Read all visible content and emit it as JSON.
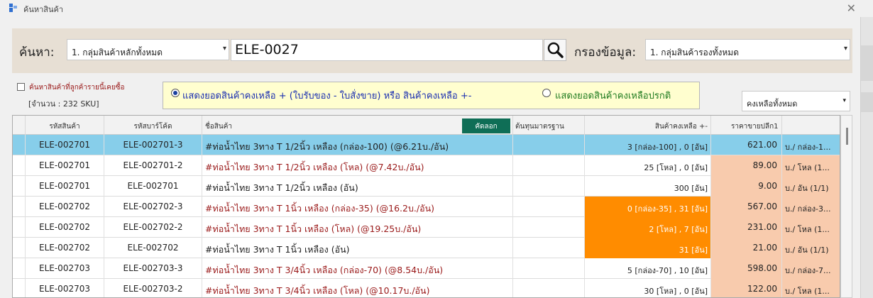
{
  "window": {
    "title": "ค้นหาสินค้า"
  },
  "search": {
    "label": "ค้นหา:",
    "group": "1. กลุ่มสินค้าหลักทั้งหมด",
    "query": "ELE-0027",
    "filter_label": "กรองข้อมูล:",
    "filter": "1. กลุ่มสินค้ารองทั้งหมด"
  },
  "options": {
    "customer_checkbox": "ค้นหาสินค้าที่ลูกค้ารายนี้เคยซื้อ",
    "sku_count": "[จำนวน : 232 SKU]",
    "radio1": "แสดงยอดสินค้าคงเหลือ + (ใบรับของ - ใบสั่งขาย)   หรือ   สินค้าคงเหลือ +-",
    "radio2": "แสดงยอดสินค้าคงเหลือปรกติ",
    "stock_filter": "คงเหลือทั้งหมด"
  },
  "grid": {
    "headers": [
      "รหัสสินค้า",
      "รหัสบาร์โค้ด",
      "ชื่อสินค้า",
      "ต้นทุนมาตรฐาน",
      "สินค้าคงเหลือ +-",
      "ราคาขายปลีก1"
    ],
    "copy_label": "คัดลอก",
    "rows": [
      {
        "code": "ELE-002701",
        "barcode": "ELE-002701-3",
        "name": "#ท่อน้ำไทย 3ทาง T 1/2นิ้ว เหลือง (กล่อง-100) (@6.21บ./อัน)",
        "cost": "",
        "stock": "3 [กล่อง-100] , 0 [อัน]",
        "price": "621.00",
        "unit": "บ./ กล่อง-1..."
      },
      {
        "code": "ELE-002701",
        "barcode": "ELE-002701-2",
        "name": "#ท่อน้ำไทย 3ทาง T 1/2นิ้ว เหลือง (โหล) (@7.42บ./อัน)",
        "cost": "",
        "stock": "25 [โหล] , 0 [อัน]",
        "price": "89.00",
        "unit": "บ./ โหล (1..."
      },
      {
        "code": "ELE-002701",
        "barcode": "ELE-002701",
        "name": "#ท่อน้ำไทย 3ทาง T 1/2นิ้ว เหลือง (อัน)",
        "cost": "",
        "stock": "300 [อัน]",
        "price": "9.00",
        "unit": "บ./ อัน (1/1)"
      },
      {
        "code": "ELE-002702",
        "barcode": "ELE-002702-3",
        "name": "#ท่อน้ำไทย 3ทาง T 1นิ้ว เหลือง (กล่อง-35) (@16.2บ./อัน)",
        "cost": "",
        "stock": "0 [กล่อง-35] , 31 [อัน]",
        "price": "567.00",
        "unit": "บ./ กล่อง-3..."
      },
      {
        "code": "ELE-002702",
        "barcode": "ELE-002702-2",
        "name": "#ท่อน้ำไทย 3ทาง T 1นิ้ว เหลือง (โหล) (@19.25บ./อัน)",
        "cost": "",
        "stock": "2 [โหล] , 7 [อัน]",
        "price": "231.00",
        "unit": "บ./ โหล (1..."
      },
      {
        "code": "ELE-002702",
        "barcode": "ELE-002702",
        "name": "#ท่อน้ำไทย 3ทาง T 1นิ้ว เหลือง (อัน)",
        "cost": "",
        "stock": "31 [อัน]",
        "price": "21.00",
        "unit": "บ./ อัน (1/1)"
      },
      {
        "code": "ELE-002703",
        "barcode": "ELE-002703-3",
        "name": "#ท่อน้ำไทย 3ทาง T 3/4นิ้ว เหลือง (กล่อง-70) (@8.54บ./อัน)",
        "cost": "",
        "stock": "5 [กล่อง-70] , 10 [อัน]",
        "price": "598.00",
        "unit": "บ./ กล่อง-7..."
      },
      {
        "code": "ELE-002703",
        "barcode": "ELE-002703-2",
        "name": "#ท่อน้ำไทย 3ทาง T 3/4นิ้ว เหลือง (โหล) (@10.17บ./อัน)",
        "cost": "",
        "stock": "30 [โหล] , 0 [อัน]",
        "price": "122.00",
        "unit": "บ./ โหล (1..."
      }
    ]
  },
  "colors": {
    "selected_row": "#87ceea",
    "low_stock": "#ff8c00",
    "price_bg": "#f8cbad",
    "copy_button": "#0f6e56"
  }
}
